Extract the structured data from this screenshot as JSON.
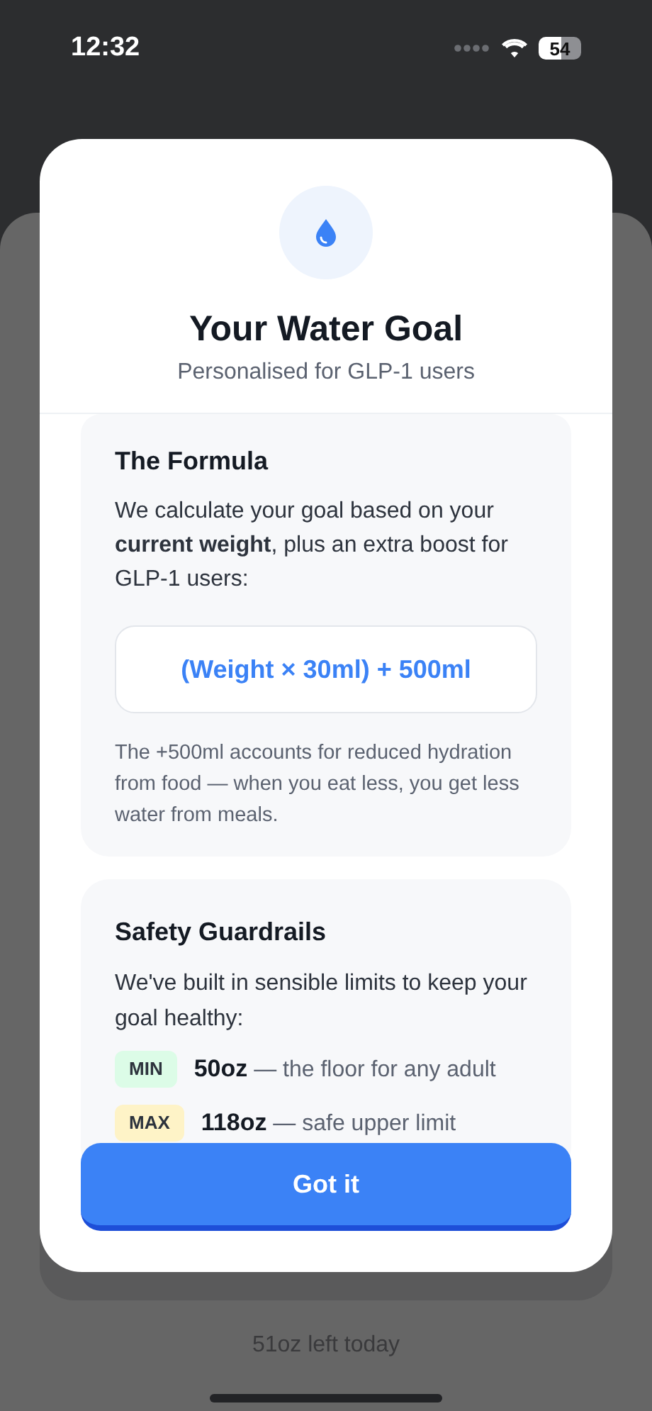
{
  "status_bar": {
    "time": "12:32",
    "battery": "54"
  },
  "background": {
    "footer": "51oz left today"
  },
  "modal": {
    "title": "Your Water Goal",
    "subtitle": "Personalised for GLP-1 users",
    "formula_card": {
      "title": "The Formula",
      "body": "We calculate your goal based on your **current weight**, plus an extra boost for GLP-1 users:",
      "formula": "(Weight × 30ml) + 500ml",
      "note": "The +500ml accounts for reduced hydration from food — when you eat less, you get less water from meals."
    },
    "guardrails_card": {
      "title": "Safety Guardrails",
      "body": "We've built in sensible limits to keep your goal healthy:",
      "limits": [
        {
          "tag": "MIN",
          "color": "#dcfce7",
          "value": "50oz",
          "text": "— the floor for any adult"
        },
        {
          "tag": "MAX",
          "color": "#fef3c7",
          "value": "118oz",
          "text": "— safe upper limit"
        }
      ]
    },
    "button": "Got it"
  }
}
